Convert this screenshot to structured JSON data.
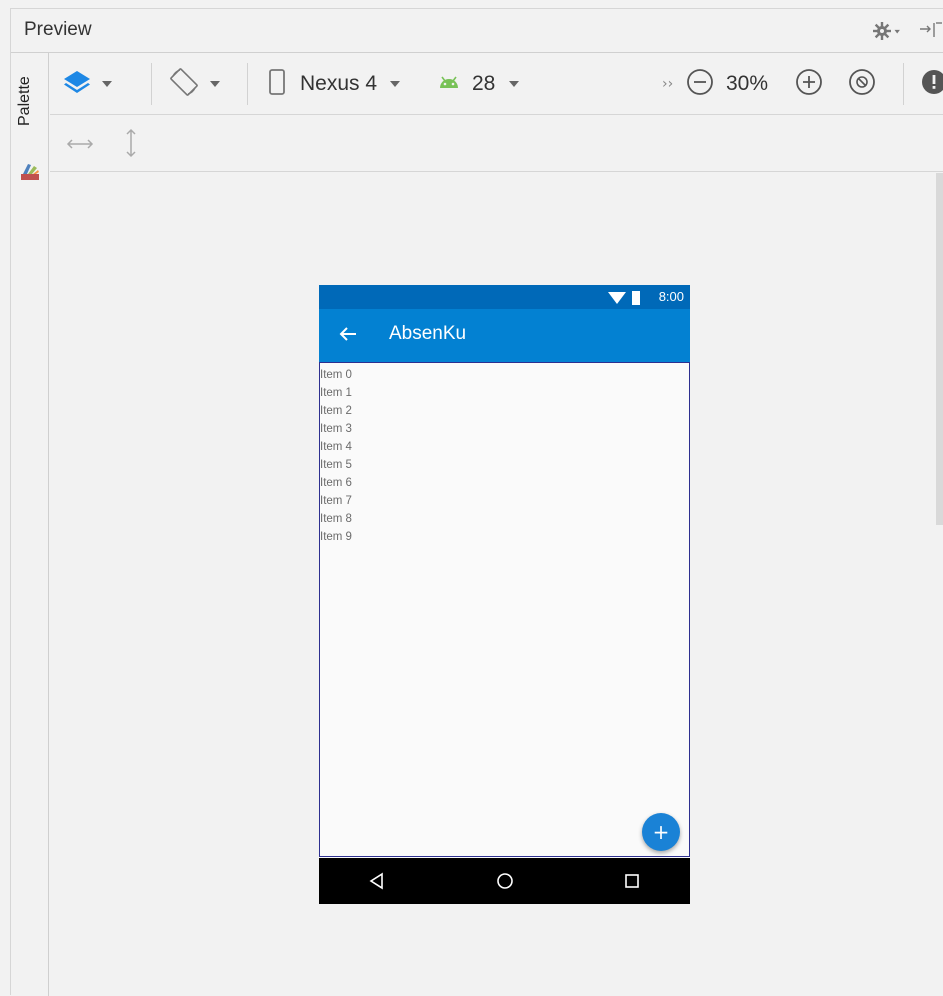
{
  "window": {
    "title": "Preview"
  },
  "palette": {
    "label": "Palette"
  },
  "toolbar": {
    "device_name": "Nexus 4",
    "api_level": "28",
    "overflow": "››",
    "zoom_level": "30%"
  },
  "phone": {
    "status_time": "8:00",
    "app_title": "AbsenKu",
    "list_items": [
      "Item 0",
      "Item 1",
      "Item 2",
      "Item 3",
      "Item 4",
      "Item 5",
      "Item 6",
      "Item 7",
      "Item 8",
      "Item 9"
    ],
    "fab_label": "+"
  },
  "colors": {
    "status_bar": "#0069b8",
    "app_bar": "#0381d2",
    "fab": "#1a82d6",
    "nav_bar": "#000000",
    "design_outline": "#2d2f8f",
    "layer_icon": "#1e88e5",
    "android_icon": "#78c257"
  },
  "icons": {
    "settings": "gear-icon",
    "hide": "hide-panel-icon",
    "design_surface": "layers-icon",
    "orientation": "rotate-icon",
    "device": "phone-icon",
    "api": "android-icon",
    "zoom_out": "zoom-out-icon",
    "zoom_in": "zoom-in-icon",
    "zoom_fit": "zoom-fit-icon",
    "issues": "warning-icon",
    "resize_horizontal": "resize-horizontal-icon",
    "resize_vertical": "resize-vertical-icon"
  }
}
